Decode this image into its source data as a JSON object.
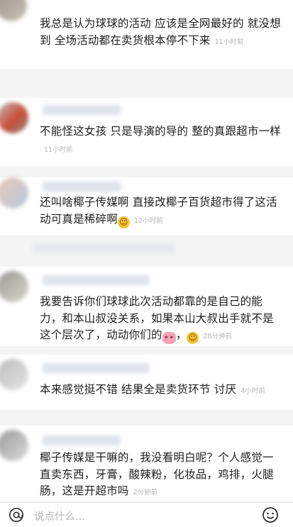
{
  "comments": [
    {
      "text": "我总是认为球球的活动 应该是全网最好的  就没想到 全场活动都在卖货根本停不下来",
      "time": "11小时前"
    },
    {
      "text": "不能怪这女孩 只是导演的导的 整的真跟超市一样",
      "time": "11小时前"
    },
    {
      "text": "还叫啥椰子传媒啊 直接改椰子百货超市得了这活动可真是稀碎啊",
      "time": "12小时前",
      "emoji": "laugh-emoji"
    },
    {
      "text_a": "我要告诉你们球球此次活动都靠的是自己的能力，和本山叔没关系，如果本山大叔出手就不是这个层次了，动动你们的",
      "text_b": "，",
      "time": "28分钟前",
      "emoji_1": "pig-emoji",
      "emoji_2": "laugh-emoji"
    },
    {
      "text": "本来感觉挺不错 结果全是卖货环节 讨厌",
      "time": "4小时前"
    },
    {
      "text": "椰子传媒是干嘛的，我没看明白呢？个人感觉一直卖东西，牙膏，酸辣粉，化妆品，鸡排，火腿肠，这是开超市吗",
      "time": "2分钟前"
    }
  ],
  "input": {
    "placeholder": "说点什么..."
  },
  "icons": {
    "mention": "at-icon",
    "emoji": "smile-icon"
  },
  "colors": {
    "text": "#1e1e1e",
    "time": "#b4b4b4",
    "placeholder": "#b5b5b5",
    "emoji": "#f7c531"
  }
}
